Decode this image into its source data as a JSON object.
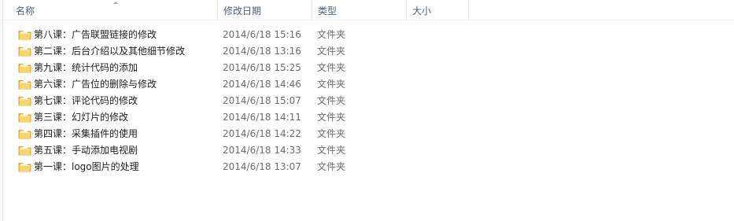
{
  "columns": {
    "name": "名称",
    "date": "修改日期",
    "type": "类型",
    "size": "大小"
  },
  "folder_icon": "folder-icon",
  "files": [
    {
      "name": "第八课：广告联盟链接的修改",
      "date": "2014/6/18 15:16",
      "type": "文件夹"
    },
    {
      "name": "第二课：后台介绍以及其他细节修改",
      "date": "2014/6/18 13:16",
      "type": "文件夹"
    },
    {
      "name": "第九课：统计代码的添加",
      "date": "2014/6/18 15:25",
      "type": "文件夹"
    },
    {
      "name": "第六课：广告位的删除与修改",
      "date": "2014/6/18 14:46",
      "type": "文件夹"
    },
    {
      "name": "第七课：评论代码的修改",
      "date": "2014/6/18 15:07",
      "type": "文件夹"
    },
    {
      "name": "第三课：幻灯片的修改",
      "date": "2014/6/18 14:11",
      "type": "文件夹"
    },
    {
      "name": "第四课：采集插件的使用",
      "date": "2014/6/18 14:22",
      "type": "文件夹"
    },
    {
      "name": "第五课：手动添加电视剧",
      "date": "2014/6/18 14:33",
      "type": "文件夹"
    },
    {
      "name": "第一课：logo图片的处理",
      "date": "2014/6/18 13:07",
      "type": "文件夹"
    }
  ],
  "colors": {
    "header_text": "#4c607a",
    "folder_yellow": "#f2c94c",
    "meta_text": "#6d6d6d"
  }
}
